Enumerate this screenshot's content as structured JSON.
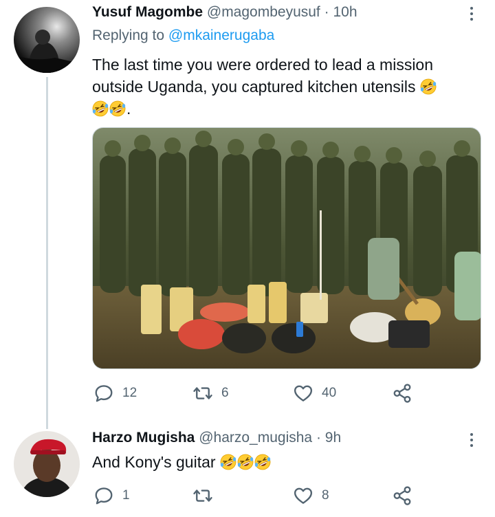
{
  "tweets": [
    {
      "author_name": "Yusuf Magombe",
      "handle": "@magombeyusuf",
      "separator": "·",
      "time": "10h",
      "replying_prefix": "Replying to",
      "replying_to": "@mkainerugaba",
      "text_line1": "The last time you were ordered to lead a mission",
      "text_line2": "outside Uganda,  you captured kitchen utensils",
      "text_end": ".",
      "emoji": "rolling-on-floor-laughing",
      "reply_count": "12",
      "retweet_count": "6",
      "like_count": "40"
    },
    {
      "author_name": "Harzo Mugisha",
      "handle": "@harzo_mugisha",
      "separator": "·",
      "time": "9h",
      "text": "And Kony's guitar",
      "emoji": "rolling-on-floor-laughing",
      "reply_count": "1",
      "retweet_count": "",
      "like_count": "8"
    }
  ],
  "icons": {
    "reply": "reply-icon",
    "retweet": "retweet-icon",
    "like": "heart-icon",
    "share": "share-icon",
    "more": "more-options-icon"
  },
  "colors": {
    "text": "#0f1419",
    "secondary": "#536471",
    "link": "#1d9bf0",
    "thread_line": "#cfd9de"
  }
}
